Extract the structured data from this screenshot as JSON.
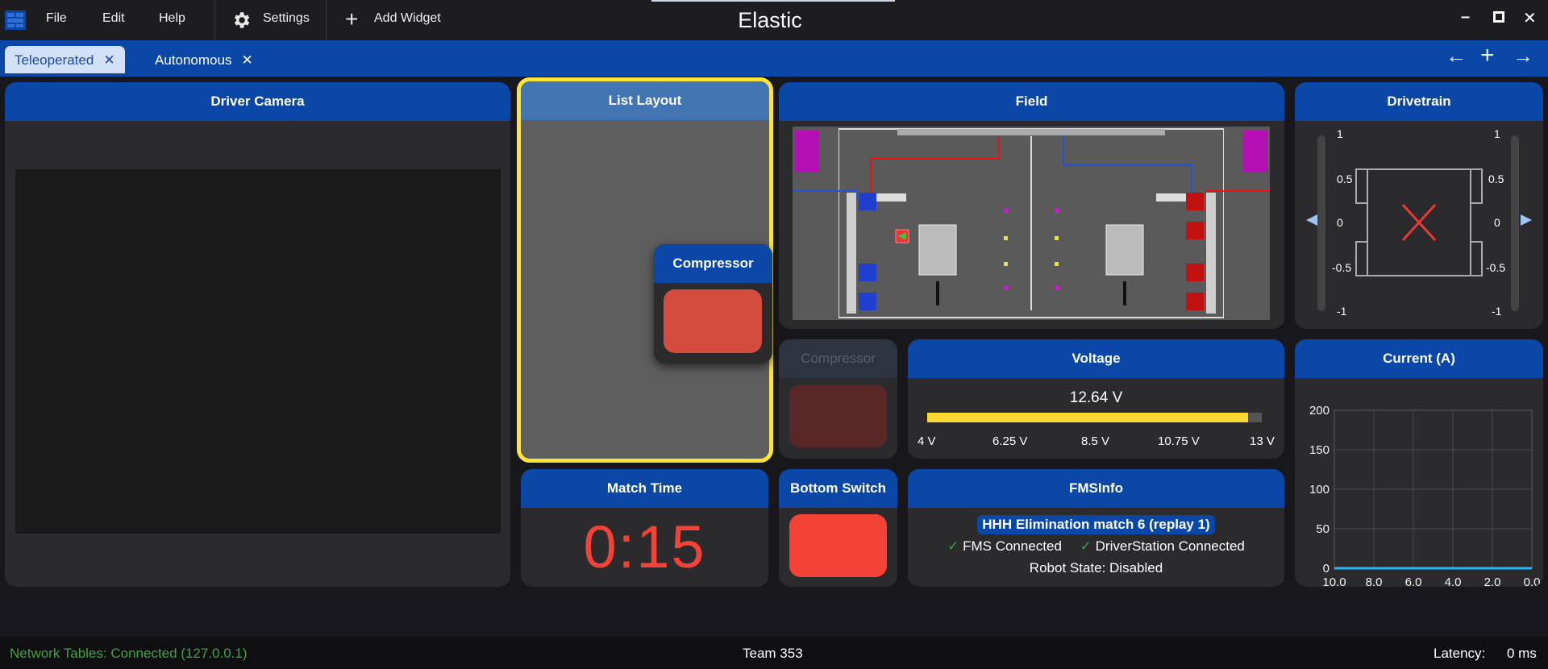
{
  "app": {
    "title": "Elastic"
  },
  "menu": {
    "file": "File",
    "edit": "Edit",
    "help": "Help",
    "settings": "Settings",
    "add_widget": "Add Widget"
  },
  "tabs": [
    {
      "label": "Teleoperated",
      "active": true
    },
    {
      "label": "Autonomous",
      "active": false
    }
  ],
  "nav": {
    "back": "←",
    "add": "+",
    "forward": "→"
  },
  "widgets": {
    "driver_camera": {
      "title": "Driver Camera"
    },
    "list_layout": {
      "title": "List Layout"
    },
    "compressor_drag": {
      "title": "Compressor"
    },
    "field": {
      "title": "Field"
    },
    "drivetrain": {
      "title": "Drivetrain",
      "ticks": [
        "1",
        "0.5",
        "0",
        "-0.5",
        "-1"
      ]
    },
    "compressor": {
      "title": "Compressor"
    },
    "voltage": {
      "title": "Voltage",
      "value_text": "12.64 V",
      "value": 12.64,
      "min": 4,
      "max": 13,
      "ticks": [
        "4 V",
        "6.25 V",
        "8.5 V",
        "10.75 V",
        "13 V"
      ]
    },
    "current": {
      "title": "Current (A)"
    },
    "match_time": {
      "title": "Match Time",
      "value": "0:15"
    },
    "bottom_switch": {
      "title": "Bottom Switch"
    },
    "fms_info": {
      "title": "FMSInfo",
      "match": "HHH Elimination match 6 (replay 1)",
      "fms": "FMS Connected",
      "ds": "DriverStation Connected",
      "state": "Robot State: Disabled"
    }
  },
  "chart_data": {
    "type": "line",
    "title": "Current (A)",
    "x": [
      10.0,
      8.0,
      6.0,
      4.0,
      2.0,
      0.0
    ],
    "series": [
      {
        "values": [
          0,
          0,
          0,
          0,
          0,
          0
        ]
      }
    ],
    "xticks": [
      "10.0",
      "8.0",
      "6.0",
      "4.0",
      "2.0",
      "0.0"
    ],
    "yticks": [
      "200",
      "150",
      "100",
      "50",
      "0"
    ],
    "ylim": [
      0,
      200
    ],
    "xlim": [
      10.0,
      0.0
    ],
    "grid": true,
    "line_color": "#29b6f6"
  },
  "status": {
    "network": "Network Tables: Connected (127.0.0.1)",
    "team": "Team 353",
    "latency_label": "Latency:",
    "latency_value": "0 ms"
  },
  "colors": {
    "accent": "#0a47a6",
    "selected": "#fde33a",
    "red": "#f44336",
    "green": "#43a047"
  }
}
